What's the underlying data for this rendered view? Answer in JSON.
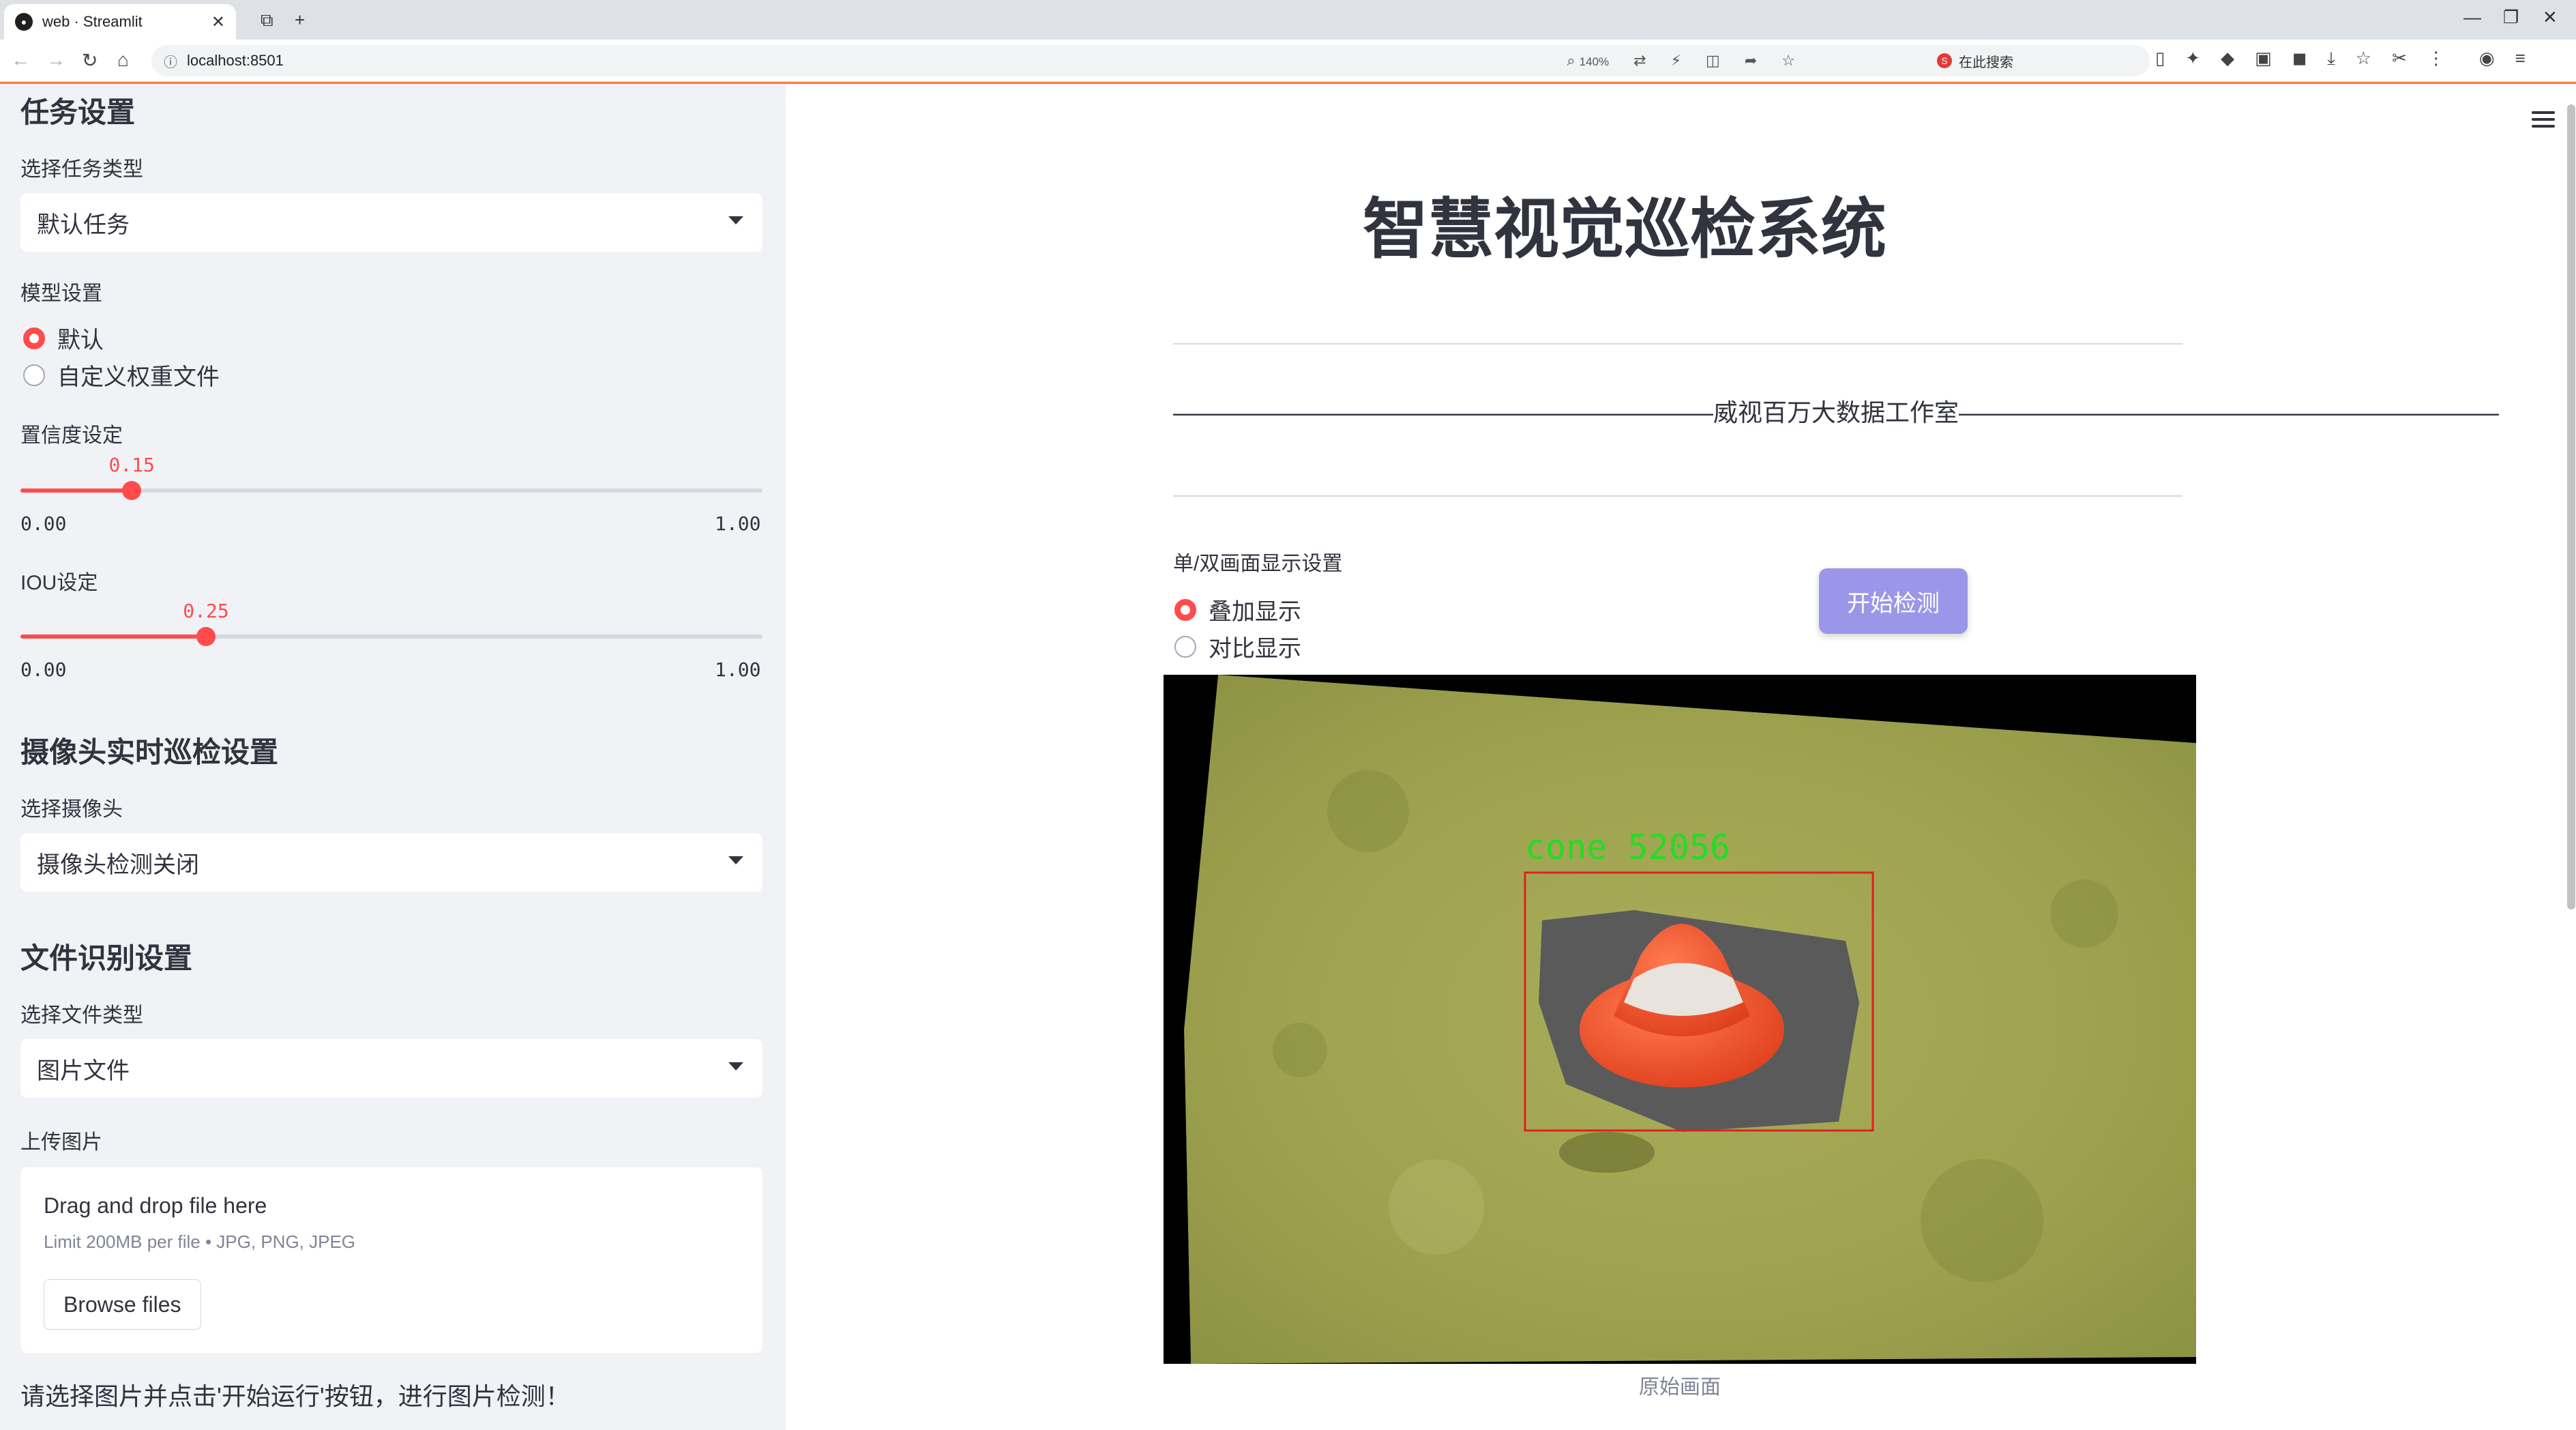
{
  "browser": {
    "tab_title": "web · Streamlit",
    "url": "localhost:8501",
    "zoom": "140%",
    "search_placeholder": "在此搜索"
  },
  "sidebar": {
    "task_header": "任务设置",
    "task_type_label": "选择任务类型",
    "task_type_value": "默认任务",
    "model_label": "模型设置",
    "model_options": [
      "默认",
      "自定义权重文件"
    ],
    "model_selected": 0,
    "conf_label": "置信度设定",
    "conf": {
      "value": "0.15",
      "fraction": 0.15,
      "min": "0.00",
      "max": "1.00"
    },
    "iou_label": "IOU设定",
    "iou": {
      "value": "0.25",
      "fraction": 0.25,
      "min": "0.00",
      "max": "1.00"
    },
    "camera_header": "摄像头实时巡检设置",
    "camera_label": "选择摄像头",
    "camera_value": "摄像头检测关闭",
    "file_header": "文件识别设置",
    "file_type_label": "选择文件类型",
    "file_type_value": "图片文件",
    "upload_label": "上传图片",
    "upload_title": "Drag and drop file here",
    "upload_limit": "Limit 200MB per file • JPG, PNG, JPEG",
    "browse_label": "Browse files",
    "hint": "请选择图片并点击'开始运行'按钮，进行图片检测！"
  },
  "main": {
    "title": "智慧视觉巡检系统",
    "subtitle": "——————————————————————威视百万大数据工作室——————————————————————",
    "display_label": "单/双画面显示设置",
    "display_options": [
      "叠加显示",
      "对比显示"
    ],
    "display_selected": 0,
    "start_button": "开始检测",
    "detection_label": "cone 52056",
    "image_caption": "原始画面"
  },
  "colors": {
    "accent": "#ff4b4b",
    "button": "#9b97e8",
    "sidebar_bg": "#f0f2f6",
    "detection_box": "#e02020",
    "detection_text": "#22dd22"
  }
}
